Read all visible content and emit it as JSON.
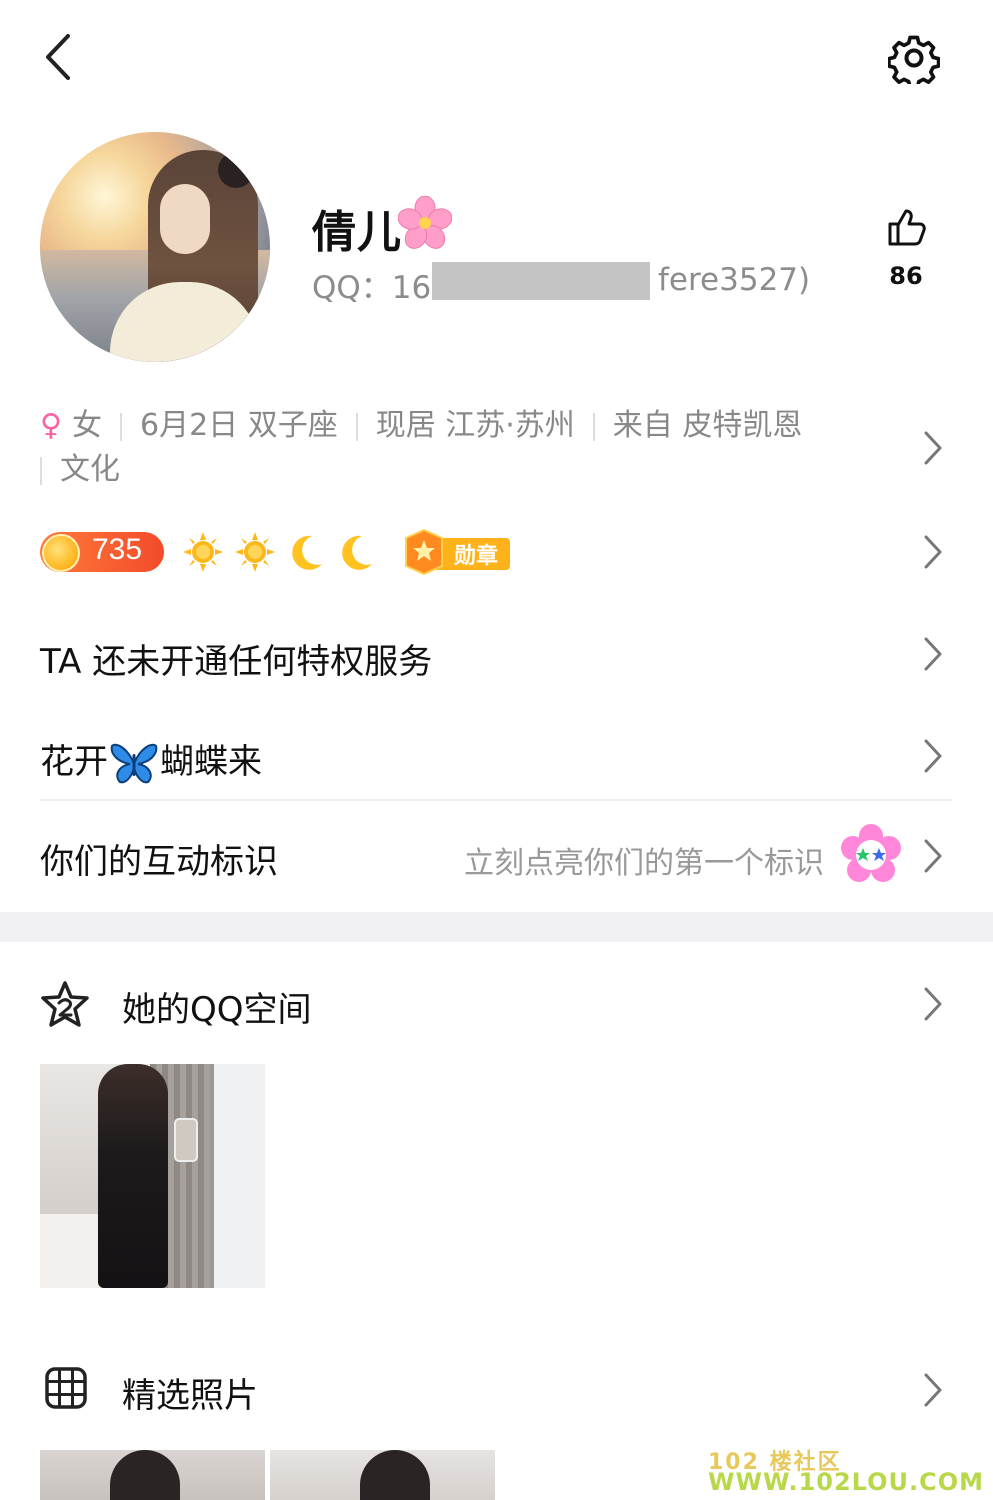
{
  "profile": {
    "nickname": "倩儿",
    "nickname_emoji": "cherry-blossom",
    "qq_prefix": "QQ：165",
    "qq_suffix": "fere3527)",
    "likes": "86"
  },
  "info": {
    "gender_symbol": "♀",
    "gender": "女",
    "birthday_sign": "6月2日 双子座",
    "location": "现居 江苏·苏州",
    "hometown": "来自 皮特凯恩",
    "hometown_wrap": "文化"
  },
  "badges": {
    "level": "735",
    "medal_label": "勋章",
    "icons": [
      "sun-icon",
      "sun-icon",
      "moon-icon",
      "moon-icon"
    ]
  },
  "rows": {
    "privilege": "TA 还未开通任何特权服务",
    "signature_left": "花开",
    "signature_right": "蝴蝶来",
    "interaction_title": "你们的互动标识",
    "interaction_hint": "立刻点亮你们的第一个标识"
  },
  "zone": {
    "title": "她的QQ空间"
  },
  "photos": {
    "title": "精选照片"
  },
  "watermark": {
    "line1": "102 楼社区",
    "line2": "WWW.102LOU.COM"
  },
  "colors": {
    "accent_pink": "#ff5fa3",
    "level_orange": "#f24b2b",
    "muted_text": "#888888",
    "section_gap": "#f1f1f3"
  }
}
